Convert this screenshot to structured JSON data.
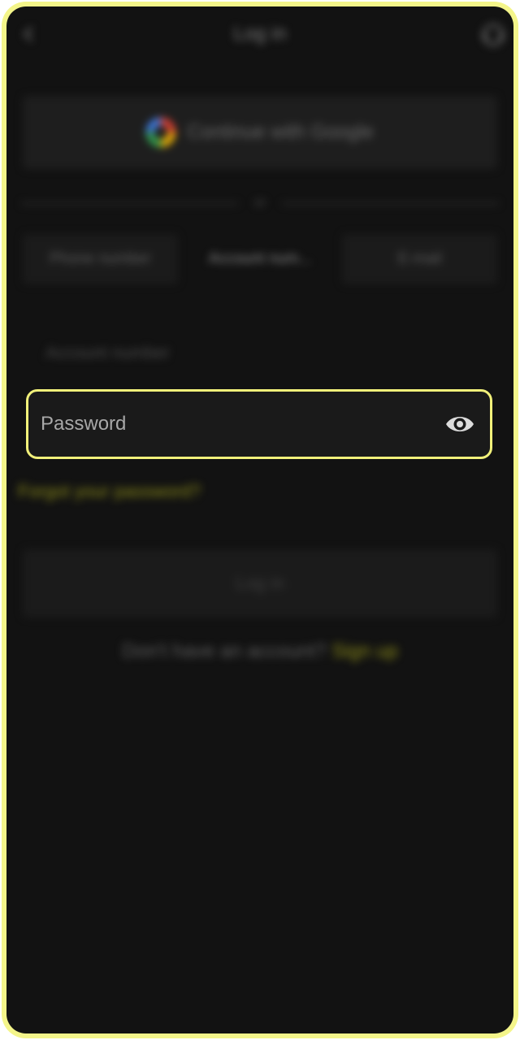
{
  "header": {
    "title": "Log in"
  },
  "google": {
    "label": "Continue with Google"
  },
  "divider": {
    "text": "or"
  },
  "tabs": [
    {
      "label": "Phone number"
    },
    {
      "label": "Account num..."
    },
    {
      "label": "E-mail"
    }
  ],
  "account": {
    "placeholder": "Account number"
  },
  "password": {
    "placeholder": "Password",
    "value": ""
  },
  "forgot": {
    "label": "Forgot your password?"
  },
  "login": {
    "label": "Log in"
  },
  "signup": {
    "prompt": "Don't have an account?",
    "link": "Sign up"
  },
  "colors": {
    "accent": "#f1f07a",
    "background": "#121212"
  }
}
